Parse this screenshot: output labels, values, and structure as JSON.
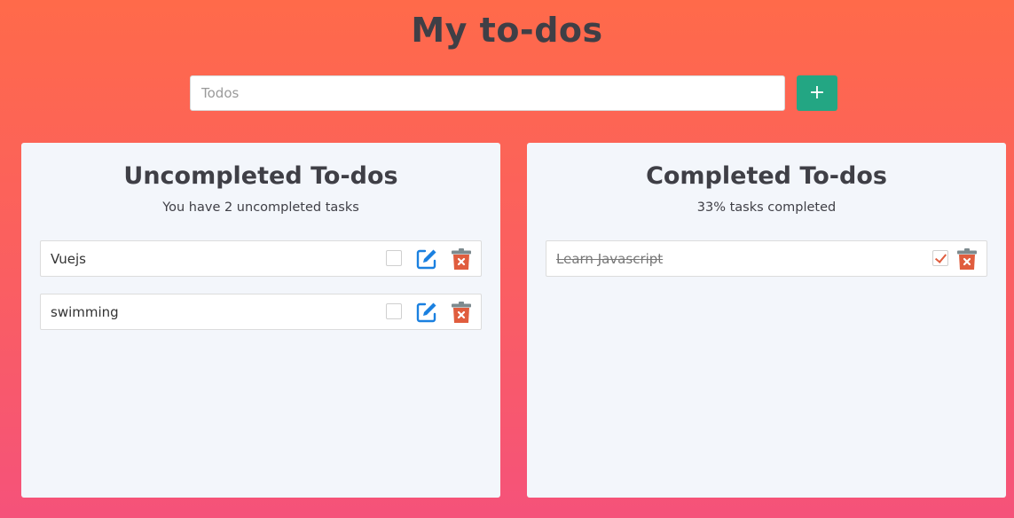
{
  "header": {
    "title": "My to-dos"
  },
  "add_bar": {
    "placeholder": "Todos",
    "value": "",
    "add_button_label": "+"
  },
  "uncompleted": {
    "title": "Uncompleted To-dos",
    "subtitle": "You have 2 uncompleted tasks",
    "items": [
      {
        "text": "Vuejs",
        "checked": false
      },
      {
        "text": "swimming",
        "checked": false
      }
    ]
  },
  "completed": {
    "title": "Completed To-dos",
    "subtitle": "33% tasks completed",
    "items": [
      {
        "text": "Learn Javascript",
        "checked": true
      }
    ]
  },
  "icons": {
    "edit": "edit-icon",
    "delete": "trash-icon",
    "check": "check-icon"
  },
  "colors": {
    "background_top": "#ff6a4a",
    "background_bottom": "#f5527a",
    "add_button": "#23a683",
    "edit_icon": "#1a80e0",
    "trash_icon": "#e05d3e",
    "title_text": "#3f3f46"
  }
}
